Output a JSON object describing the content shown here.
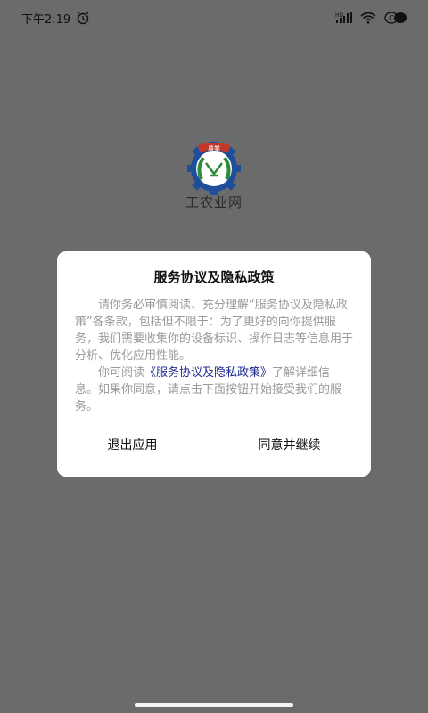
{
  "status_bar": {
    "time": "下午2:19",
    "icons": [
      "alarm-icon",
      "hd-signal-icon",
      "wifi-icon",
      "battery-icon"
    ],
    "hd_label": "HD"
  },
  "app": {
    "logo_text": "農業",
    "name": "工农业网"
  },
  "dialog": {
    "title": "服务协议及隐私政策",
    "paragraph1": "请你务必审慎阅读、充分理解“服务协议及隐私政策”各条款，包括但不限于：为了更好的向你提供服务，我们需要收集你的设备标识、操作日志等信息用于分析、优化应用性能。",
    "paragraph2_prefix": "你可阅读",
    "paragraph2_link": "《服务协议及隐私政策》",
    "paragraph2_suffix": "了解详细信息。如果你同意，请点击下面按钮开始接受我们的服务。",
    "exit_button": "退出应用",
    "agree_button": "同意并继续"
  },
  "colors": {
    "overlay": "#6b6b6b",
    "link": "#1d2a8f",
    "logo_red": "#c0392b",
    "logo_green": "#2e8b3a",
    "logo_blue": "#1f4e9a"
  }
}
